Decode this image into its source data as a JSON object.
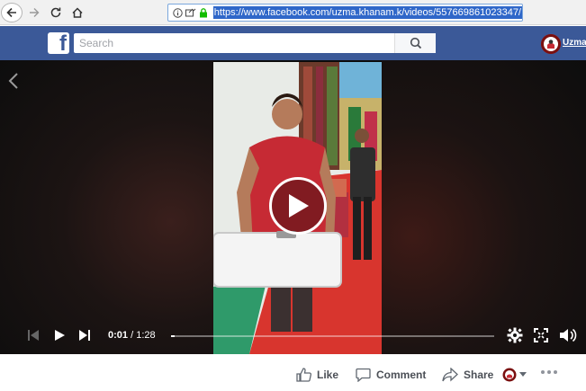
{
  "browser": {
    "url": "https://www.facebook.com/uzma.khanam.k/videos/557669861023347/"
  },
  "facebook": {
    "logo": "f",
    "search_placeholder": "Search",
    "username": "Uzma"
  },
  "video": {
    "time_current": "0:01",
    "time_separator": " / ",
    "time_total": "1:28",
    "progress_fraction": 0.012
  },
  "actions": {
    "like_label": "Like",
    "comment_label": "Comment",
    "share_label": "Share"
  },
  "colors": {
    "fb_blue": "#3b5998",
    "url_highlight": "#2f67c9",
    "shirt_red": "#c62a34"
  }
}
